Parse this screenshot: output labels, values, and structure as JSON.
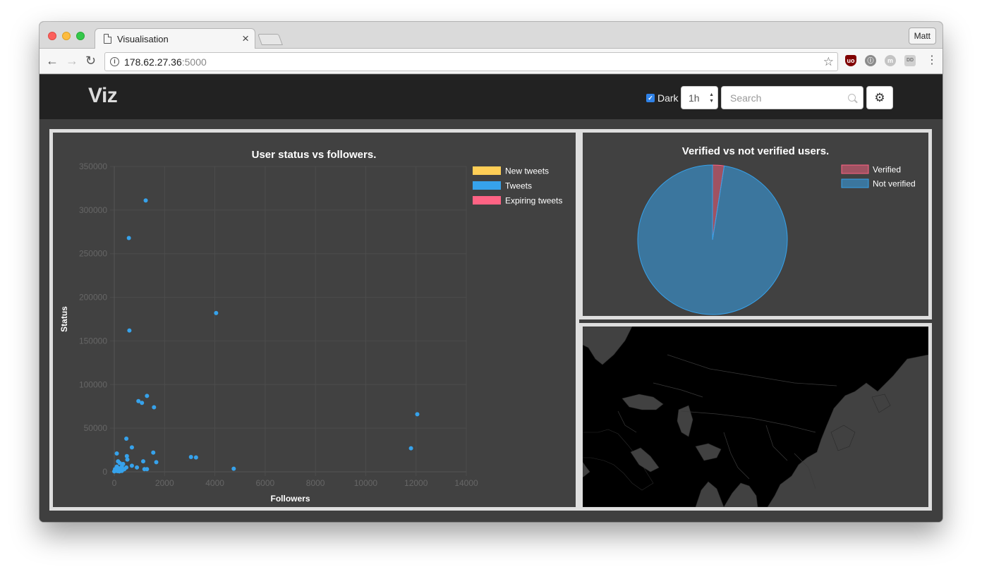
{
  "browser": {
    "tab_title": "Visualisation",
    "tab_close": "×",
    "profile": "Matt",
    "url_host": "178.62.27.36",
    "url_port": ":5000",
    "star": "☆",
    "back": "←",
    "forward": "→",
    "reload": "↻",
    "menu": "⋮"
  },
  "navbar": {
    "brand": "Viz",
    "dark_label": "Dark",
    "dark_checked": true,
    "range_value": "1h",
    "search_placeholder": "Search",
    "settings_icon": "gear-icon"
  },
  "scatter": {
    "chart_data": {
      "type": "scatter",
      "title": "User status vs followers.",
      "xlabel": "Followers",
      "ylabel": "Status",
      "xlim": [
        0,
        14000
      ],
      "ylim": [
        0,
        350000
      ],
      "xticks": [
        "0",
        "2000",
        "4000",
        "6000",
        "8000",
        "10000",
        "12000",
        "14000"
      ],
      "yticks": [
        "0",
        "50000",
        "100000",
        "150000",
        "200000",
        "250000",
        "300000",
        "350000"
      ],
      "legend": [
        {
          "name": "New tweets",
          "color": "#ffce56"
        },
        {
          "name": "Tweets",
          "color": "#36a2eb"
        },
        {
          "name": "Expiring tweets",
          "color": "#ff6384"
        }
      ],
      "series": [
        {
          "name": "Tweets",
          "color": "#36a2eb",
          "points": [
            [
              1250,
              311000
            ],
            [
              580,
              268000
            ],
            [
              600,
              162000
            ],
            [
              4050,
              182000
            ],
            [
              1300,
              87000
            ],
            [
              960,
              81000
            ],
            [
              1100,
              79000
            ],
            [
              1580,
              74000
            ],
            [
              12050,
              66000
            ],
            [
              11800,
              27000
            ],
            [
              480,
              38000
            ],
            [
              700,
              28000
            ],
            [
              1550,
              22000
            ],
            [
              100,
              21000
            ],
            [
              3050,
              17000
            ],
            [
              3250,
              16500
            ],
            [
              500,
              18000
            ],
            [
              520,
              14000
            ],
            [
              1670,
              11000
            ],
            [
              1150,
              12000
            ],
            [
              150,
              12000
            ],
            [
              220,
              10000
            ],
            [
              350,
              9000
            ],
            [
              700,
              7000
            ],
            [
              900,
              5000
            ],
            [
              4750,
              3500
            ],
            [
              1200,
              3000
            ],
            [
              1300,
              3000
            ],
            [
              480,
              5000
            ],
            [
              300,
              6000
            ],
            [
              100,
              6000
            ],
            [
              180,
              4000
            ],
            [
              250,
              2000
            ],
            [
              60,
              1500
            ],
            [
              120,
              800
            ],
            [
              0,
              500
            ],
            [
              200,
              500
            ],
            [
              300,
              1000
            ],
            [
              400,
              3000
            ],
            [
              30,
              3000
            ]
          ]
        }
      ]
    }
  },
  "pie": {
    "chart_data": {
      "type": "pie",
      "title": "Verified vs not verified users.",
      "legend_position": "top-right",
      "labels": [
        "Verified",
        "Not verified"
      ],
      "values": [
        2.5,
        97.5
      ],
      "colors": [
        "#ff6384",
        "#36a2eb"
      ]
    }
  },
  "map": {
    "label": "world-map-asia"
  }
}
